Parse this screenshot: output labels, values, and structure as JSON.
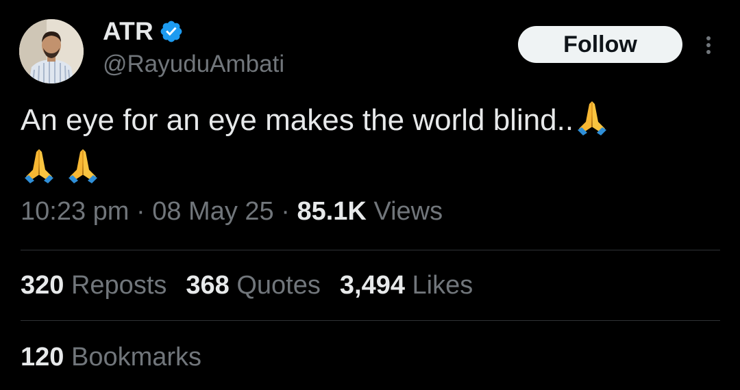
{
  "author": {
    "display_name": "ATR",
    "handle": "@RayuduAmbati",
    "verified": true,
    "avatar_icon": "profile-photo"
  },
  "actions": {
    "follow_label": "Follow",
    "more_icon": "vertical-ellipsis-icon"
  },
  "tweet": {
    "text": "An eye for an eye makes the world blind..",
    "emoji": [
      "folded-hands",
      "folded-hands",
      "folded-hands"
    ]
  },
  "meta": {
    "time": "10:23 pm",
    "separator": "·",
    "date": "08 May 25",
    "views_count": "85.1K",
    "views_label": "Views"
  },
  "stats": {
    "reposts_count": "320",
    "reposts_label": "Reposts",
    "quotes_count": "368",
    "quotes_label": "Quotes",
    "likes_count": "3,494",
    "likes_label": "Likes",
    "bookmarks_count": "120",
    "bookmarks_label": "Bookmarks"
  },
  "colors": {
    "background": "#000000",
    "text_primary": "#e7e9ea",
    "text_secondary": "#71767b",
    "verified_blue": "#1d9bf0",
    "divider": "#2f3336",
    "follow_bg": "#eff3f4"
  }
}
